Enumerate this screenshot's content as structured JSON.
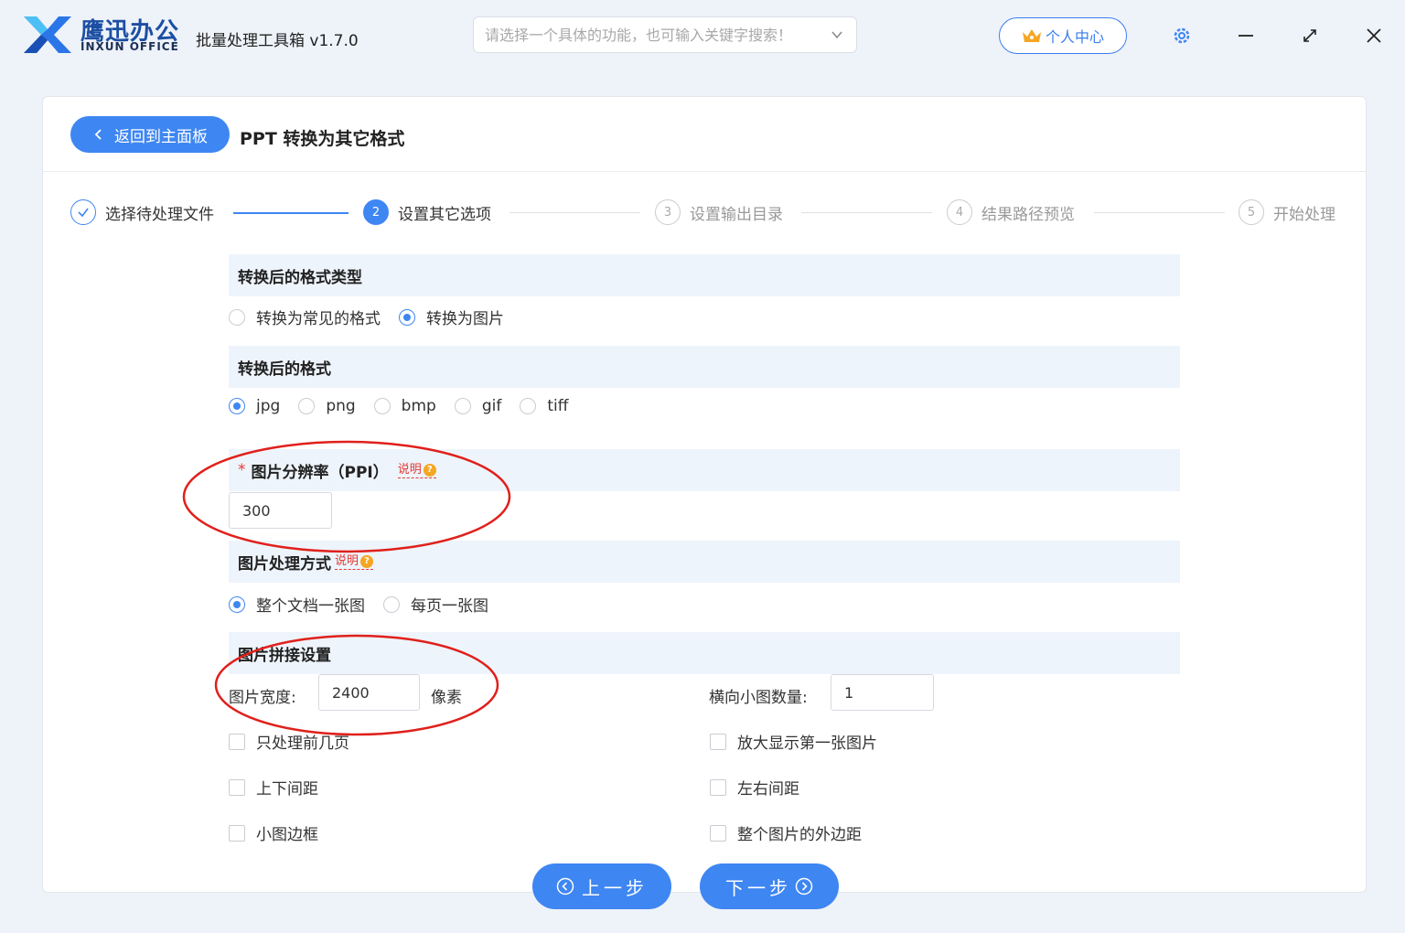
{
  "header": {
    "brand_cn": "鹰迅办公",
    "brand_en": "INXUN OFFICE",
    "app_title": "批量处理工具箱 v1.7.0",
    "search_placeholder": "请选择一个具体的功能，也可输入关键字搜索！",
    "user_center_label": "个人中心",
    "settings_icon": "gear-icon",
    "minimize_icon": "minimize-icon",
    "maximize_icon": "expand-icon",
    "close_icon": "close-icon"
  },
  "page": {
    "back_label": "返回到主面板",
    "title": "PPT 转换为其它格式"
  },
  "stepper": {
    "steps": [
      {
        "num": "",
        "label": "选择待处理文件",
        "state": "done"
      },
      {
        "num": "2",
        "label": "设置其它选项",
        "state": "active"
      },
      {
        "num": "3",
        "label": "设置输出目录",
        "state": "pending"
      },
      {
        "num": "4",
        "label": "结果路径预览",
        "state": "pending"
      },
      {
        "num": "5",
        "label": "开始处理",
        "state": "pending"
      }
    ]
  },
  "format_type": {
    "heading": "转换后的格式类型",
    "options": [
      "转换为常见的格式",
      "转换为图片"
    ],
    "selected": "转换为图片"
  },
  "format": {
    "heading": "转换后的格式",
    "options": [
      "jpg",
      "png",
      "bmp",
      "gif",
      "tiff"
    ],
    "selected": "jpg"
  },
  "resolution": {
    "required_mark": "*",
    "heading": "图片分辨率（PPI）",
    "help_label": "说明",
    "value": "300"
  },
  "processing": {
    "heading": "图片处理方式",
    "help_label": "说明",
    "options": [
      "整个文档一张图",
      "每页一张图"
    ],
    "selected": "整个文档一张图"
  },
  "stitching": {
    "heading": "图片拼接设置",
    "width_label": "图片宽度:",
    "width_value": "2400",
    "width_unit": "像素",
    "count_label": "横向小图数量:",
    "count_value": "1",
    "checkboxes": [
      {
        "label": "只处理前几页",
        "checked": false
      },
      {
        "label": "放大显示第一张图片",
        "checked": false
      },
      {
        "label": "上下间距",
        "checked": false
      },
      {
        "label": "左右间距",
        "checked": false
      },
      {
        "label": "小图边框",
        "checked": false
      },
      {
        "label": "整个图片的外边距",
        "checked": false
      }
    ]
  },
  "footer": {
    "prev_label": "上一步",
    "next_label": "下一步"
  },
  "colors": {
    "accent": "#3e86f2",
    "annotation": "#e0201b",
    "section_bg": "#eef4fb"
  }
}
